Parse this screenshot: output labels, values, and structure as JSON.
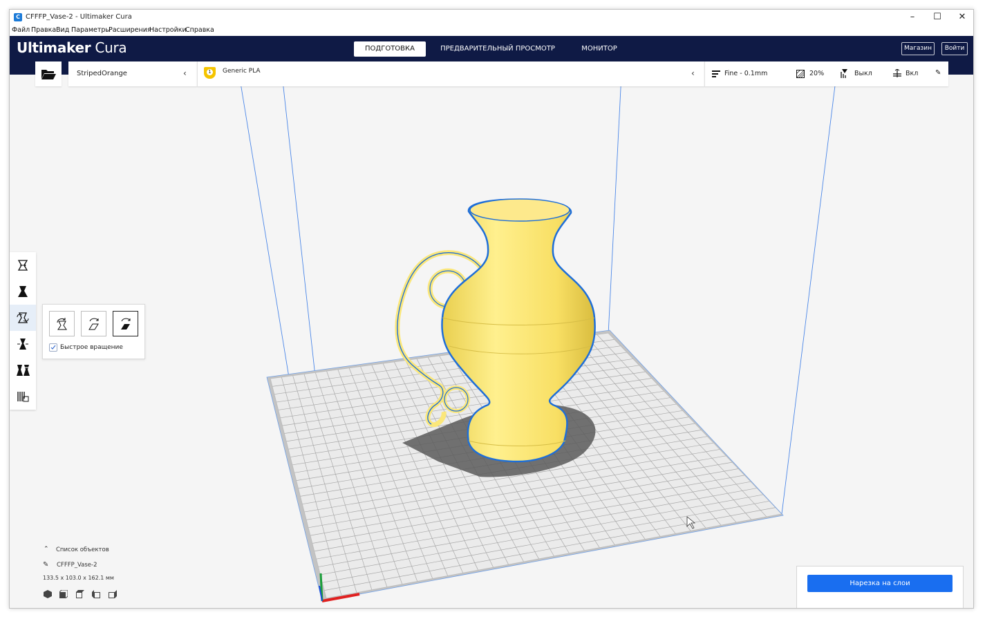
{
  "window": {
    "title": "CFFFP_Vase-2 - Ultimaker Cura",
    "minimize": "–",
    "maximize": "☐",
    "close": "✕"
  },
  "menu": [
    "Файл",
    "Правка",
    "Вид",
    "Параметры",
    "Расширения",
    "Настройки",
    "Справка"
  ],
  "header": {
    "logo_bold": "Ultimaker",
    "logo_light": "Cura",
    "stages": [
      {
        "label": "ПОДГОТОВКА",
        "active": true
      },
      {
        "label": "ПРЕДВАРИТЕЛЬНЫЙ ПРОСМОТР",
        "active": false
      },
      {
        "label": "МОНИТОР",
        "active": false
      }
    ],
    "marketplace": "Магазин",
    "signin": "Войти"
  },
  "printer": {
    "name": "StripedOrange"
  },
  "material": {
    "extruder_number": "1",
    "name": "Generic PLA"
  },
  "print_settings": {
    "profile": "Fine - 0.1mm",
    "infill": "20%",
    "support": "Выкл",
    "adhesion": "Вкл"
  },
  "tools": [
    {
      "name": "move-tool-icon"
    },
    {
      "name": "scale-tool-icon"
    },
    {
      "name": "rotate-tool-icon",
      "active": true
    },
    {
      "name": "mirror-tool-icon"
    },
    {
      "name": "per-model-settings-icon"
    },
    {
      "name": "support-blocker-icon"
    }
  ],
  "rotate_panel": {
    "snap_label": "Быстрое вращение",
    "snap_checked": true
  },
  "object_list": {
    "header": "Список объектов",
    "object_name": "CFFFP_Vase-2",
    "dimensions": "133.5 x 103.0 x 162.1 мм"
  },
  "slice_button": "Нарезка на слои",
  "colors": {
    "header_bg": "#0f1a45",
    "accent_blue": "#196ef0",
    "model_yellow": "#fbe77a",
    "model_outline": "#1e6ed8"
  }
}
